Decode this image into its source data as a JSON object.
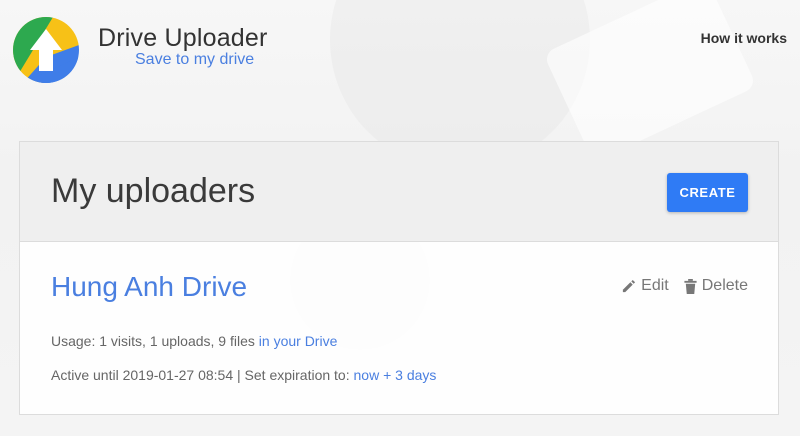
{
  "header": {
    "title": "Drive Uploader",
    "subtitle": "Save to my drive",
    "how_it_works": "How it works"
  },
  "card": {
    "title": "My uploaders",
    "create_label": "CREATE"
  },
  "uploader": {
    "name": "Hung Anh Drive",
    "edit_label": "Edit",
    "delete_label": "Delete",
    "usage_text": "Usage: 1 visits, 1 uploads, 9 files ",
    "usage_link": "in your Drive",
    "active_text": "Active until 2019-01-27 08:54 | Set expiration to: ",
    "expiration_link": "now + 3 days"
  },
  "colors": {
    "accent": "#2f7bf5",
    "link": "#4a7fe0",
    "logo_green": "#2da94f",
    "logo_yellow": "#f7c117",
    "logo_blue": "#3f7de8"
  },
  "icons": [
    "drive-uploader-logo-icon",
    "pencil-icon",
    "trash-icon"
  ]
}
